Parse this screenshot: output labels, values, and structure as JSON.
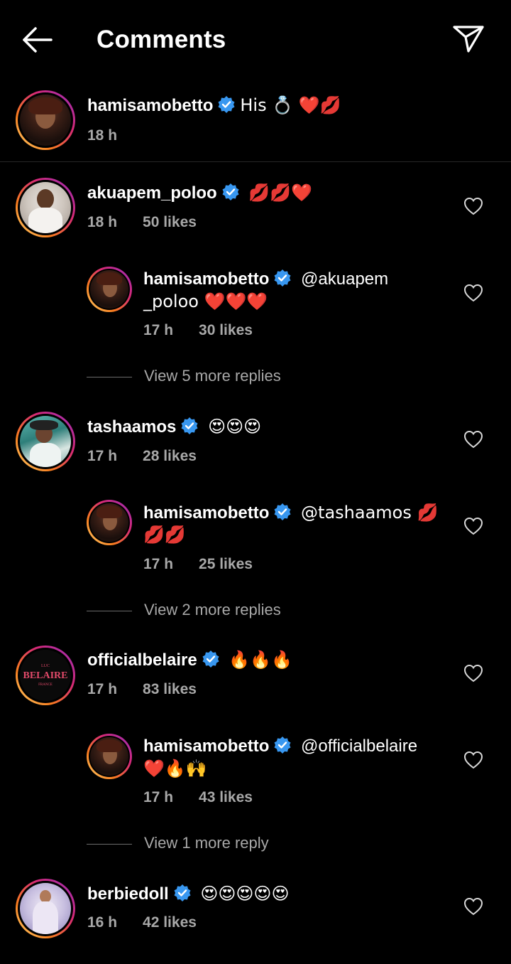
{
  "header": {
    "title": "Comments"
  },
  "caption": {
    "username": "hamisamobetto",
    "text": "His 💍 ❤️💋",
    "time": "18 h"
  },
  "comments": [
    {
      "username": "akuapem_poloo",
      "text": "💋💋❤️",
      "time": "18 h",
      "likes": "50 likes",
      "reply": {
        "username": "hamisamobetto",
        "text_line1": "@akuapem",
        "text_line2": "_poloo ❤️❤️❤️",
        "time": "17 h",
        "likes": "30 likes"
      },
      "more_replies": "View 5 more replies"
    },
    {
      "username": "tashaamos",
      "text": "😍😍😍",
      "time": "17 h",
      "likes": "28 likes",
      "reply": {
        "username": "hamisamobetto",
        "text_line1": "@tashaamos 💋",
        "text_line2": "💋💋",
        "time": "17 h",
        "likes": "25 likes"
      },
      "more_replies": "View 2 more replies"
    },
    {
      "username": "officialbelaire",
      "text": "🔥🔥🔥",
      "time": "17 h",
      "likes": "83 likes",
      "reply": {
        "username": "hamisamobetto",
        "text_line1": "@officialbelaire",
        "text_line2": "❤️🔥🙌",
        "time": "17 h",
        "likes": "43 likes"
      },
      "more_replies": "View 1 more reply"
    },
    {
      "username": "berbiedoll",
      "text": "😍😍😍😍😍",
      "time": "16 h",
      "likes": "42 likes"
    }
  ],
  "belaire_logo": {
    "top": "LUC",
    "main": "BELAIRE",
    "bottom": "FRANCE"
  },
  "colors": {
    "background": "#000000",
    "verified": "#3897f0",
    "meta": "#a8a8a8",
    "divider": "#262626"
  }
}
